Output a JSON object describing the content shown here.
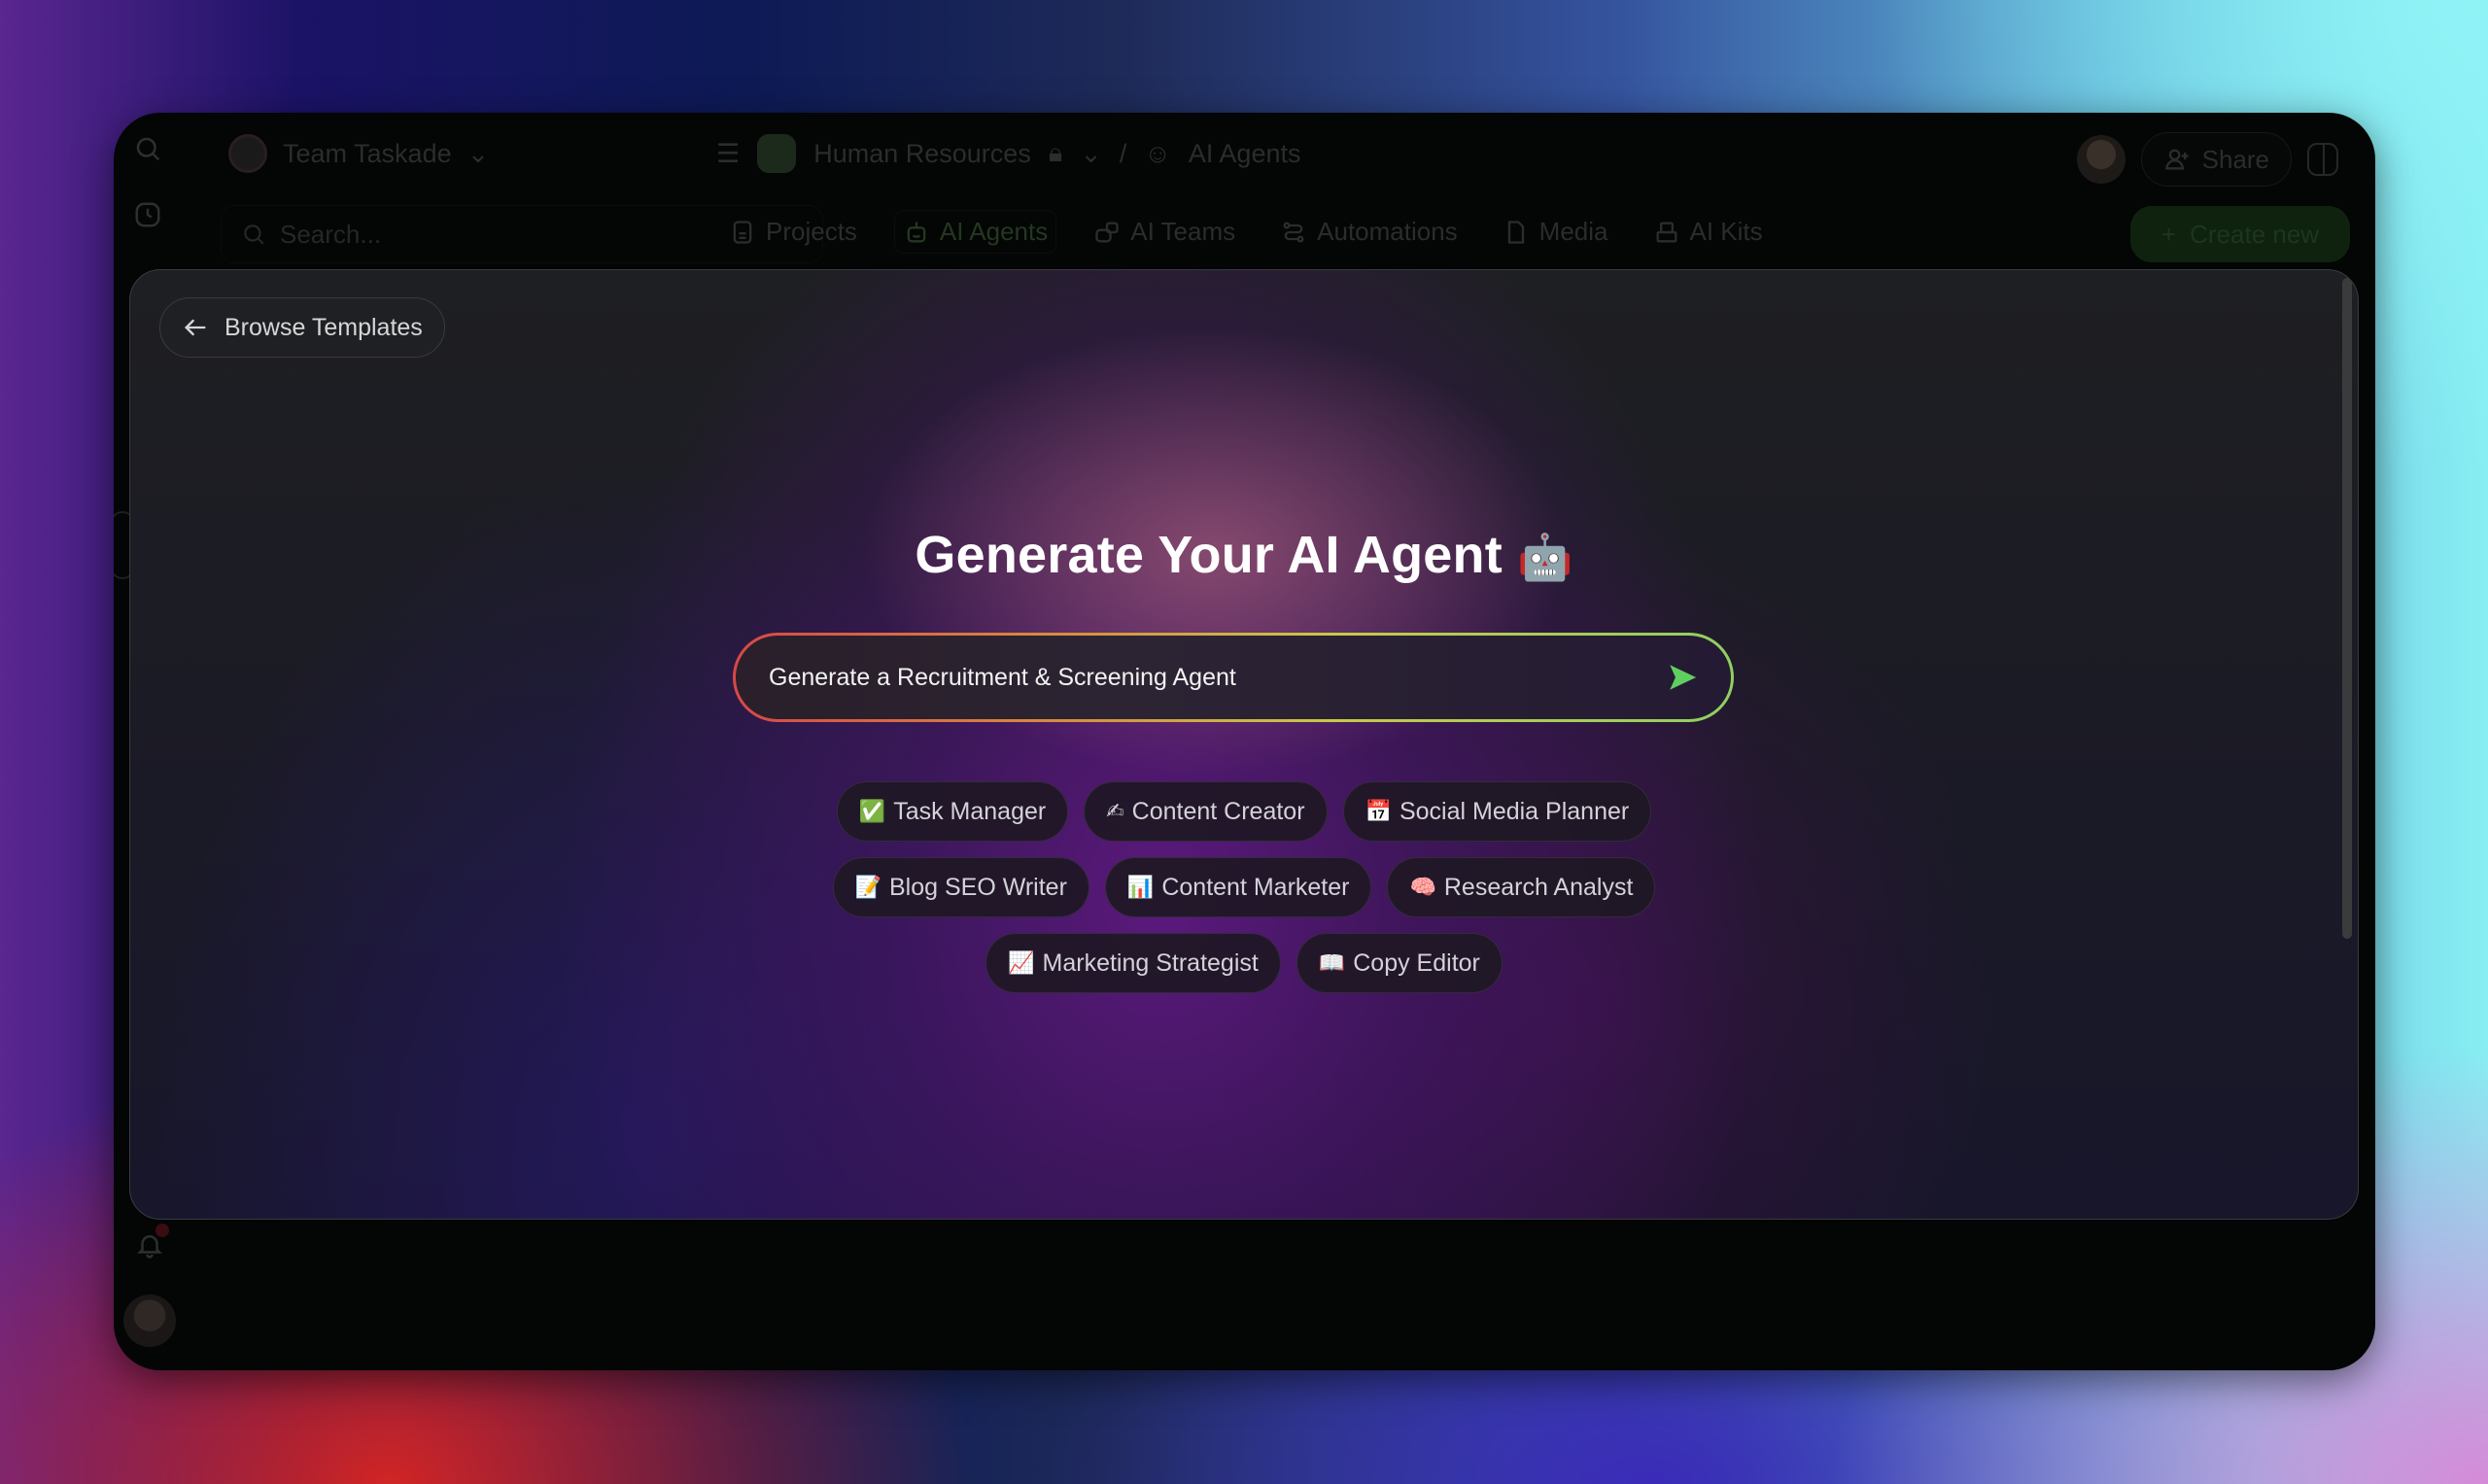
{
  "app": {
    "workspace": {
      "name": "Team Taskade"
    },
    "search": {
      "placeholder": "Search..."
    },
    "breadcrumb": {
      "space": "Human Resources",
      "current": "AI Agents"
    },
    "nav_tabs": [
      {
        "label": "Projects",
        "icon": "document-icon"
      },
      {
        "label": "AI Agents",
        "icon": "robot-icon",
        "active": true
      },
      {
        "label": "AI Teams",
        "icon": "robot-team-icon"
      },
      {
        "label": "Automations",
        "icon": "flow-icon"
      },
      {
        "label": "Media",
        "icon": "file-icon"
      },
      {
        "label": "AI Kits",
        "icon": "box-stack-icon"
      }
    ],
    "share_label": "Share",
    "create_label": "Create new"
  },
  "modal": {
    "back_label": "Browse Templates",
    "title": "Generate Your AI Agent",
    "title_emoji": "🤖",
    "prompt": {
      "value": "Generate a Recruitment & Screening Agent",
      "placeholder": ""
    },
    "suggestion_rows": [
      [
        {
          "emoji": "✅",
          "label": "Task Manager"
        },
        {
          "emoji": "✍",
          "label": "Content Creator"
        },
        {
          "emoji": "📅",
          "label": "Social Media Planner"
        }
      ],
      [
        {
          "emoji": "📝",
          "label": "Blog SEO Writer"
        },
        {
          "emoji": "📊",
          "label": "Content Marketer"
        },
        {
          "emoji": "🧠",
          "label": "Research Analyst"
        }
      ],
      [
        {
          "emoji": "📈",
          "label": "Marketing Strategist"
        },
        {
          "emoji": "📖",
          "label": "Copy Editor"
        }
      ]
    ]
  },
  "colors": {
    "accent_green": "#5fcf5f",
    "prompt_border_start": "#d64848",
    "prompt_border_end": "#8fd060"
  }
}
